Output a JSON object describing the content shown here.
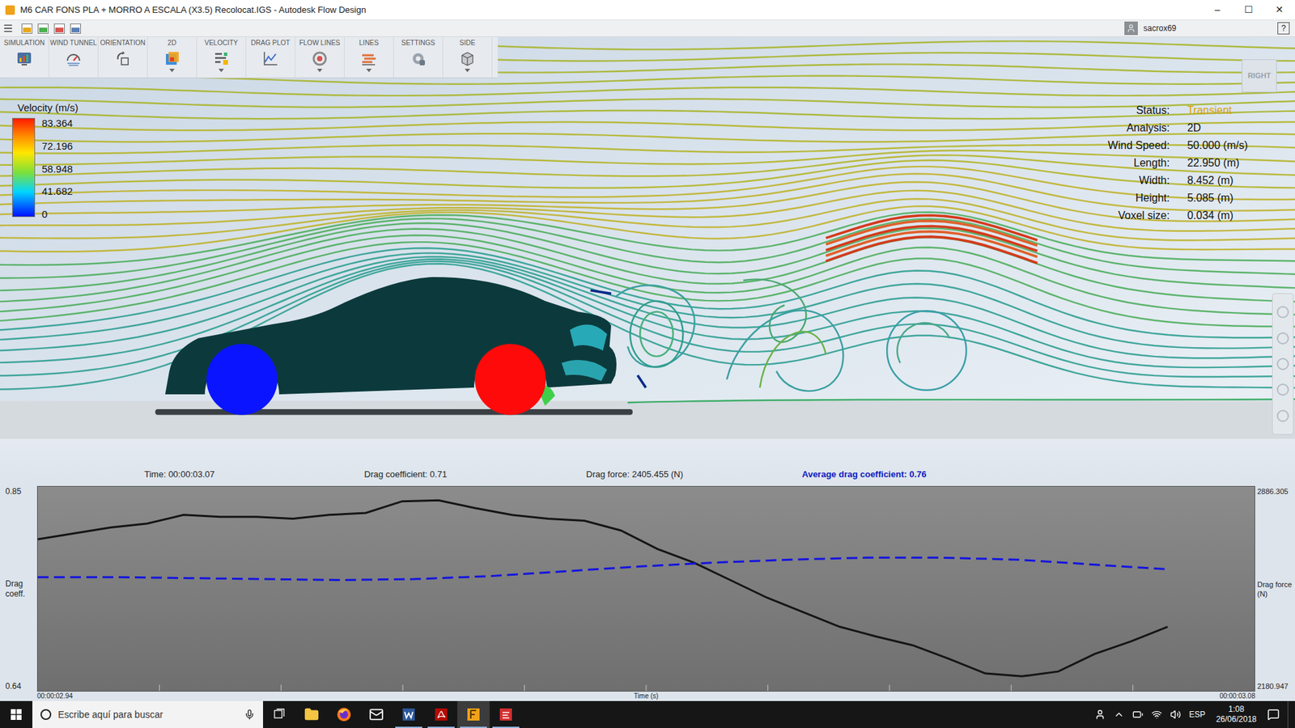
{
  "window": {
    "title": "M6 CAR FONS PLA + MORRO A ESCALA (X3.5) Recolocat.IGS - Autodesk Flow Design",
    "controls": [
      "–",
      "☐",
      "✕"
    ]
  },
  "quick_toolbar": {
    "user": "sacrox69",
    "help": "?"
  },
  "ribbon": [
    {
      "label": "SIMULATION",
      "has_dropdown": false
    },
    {
      "label": "WIND TUNNEL",
      "has_dropdown": false
    },
    {
      "label": "ORIENTATION",
      "has_dropdown": false
    },
    {
      "label": "2D",
      "has_dropdown": true
    },
    {
      "label": "VELOCITY",
      "has_dropdown": true
    },
    {
      "label": "DRAG PLOT",
      "has_dropdown": false
    },
    {
      "label": "FLOW LINES",
      "has_dropdown": true
    },
    {
      "label": "LINES",
      "has_dropdown": true
    },
    {
      "label": "SETTINGS",
      "has_dropdown": false
    },
    {
      "label": "SIDE",
      "has_dropdown": true
    }
  ],
  "legend": {
    "title": "Velocity (m/s)",
    "ticks": [
      "83.364",
      "72.196",
      "58.948",
      "41.682",
      "0"
    ]
  },
  "info": [
    {
      "label": "Status:",
      "value": "Transient",
      "highlight": true
    },
    {
      "label": "Analysis:",
      "value": "2D",
      "highlight": false
    },
    {
      "label": "Wind Speed:",
      "value": "50.000 (m/s)",
      "highlight": false
    },
    {
      "label": "Length:",
      "value": "22.950 (m)",
      "highlight": false
    },
    {
      "label": "Width:",
      "value": "8.452 (m)",
      "highlight": false
    },
    {
      "label": "Height:",
      "value": "5.085 (m)",
      "highlight": false
    },
    {
      "label": "Voxel size:",
      "value": "0.034 (m)",
      "highlight": false
    }
  ],
  "view_cube": {
    "label": "RIGHT"
  },
  "wheels": [
    {
      "color": "#0a14ff"
    },
    {
      "color": "#ff0a0a"
    }
  ],
  "readout": [
    {
      "kind": "time",
      "text": "Time: 00:00:03.07",
      "emphasis": false
    },
    {
      "kind": "coefficient",
      "text": "Drag coefficient: 0.71",
      "emphasis": false
    },
    {
      "kind": "force",
      "text": "Drag force: 2405.455 (N)",
      "emphasis": false
    },
    {
      "kind": "average",
      "text": "Average drag coefficient: 0.76",
      "emphasis": true
    }
  ],
  "chart": {
    "left_axis": {
      "label": "Drag coeff.",
      "max": "0.85",
      "min": "0.64"
    },
    "right_axis": {
      "label": "Drag force (N)",
      "max": "2886.305",
      "min": "2180.947"
    },
    "x_axis": {
      "label": "Time (s)",
      "start": "00:00:02.94",
      "end": "00:00:03.08"
    },
    "series": [
      {
        "name": "Drag coefficient",
        "color": "#151515",
        "style": "solid",
        "values": [
          0.796,
          0.802,
          0.808,
          0.812,
          0.821,
          0.819,
          0.819,
          0.817,
          0.821,
          0.823,
          0.835,
          0.836,
          0.828,
          0.821,
          0.817,
          0.815,
          0.805,
          0.786,
          0.772,
          0.754,
          0.736,
          0.721,
          0.706,
          0.696,
          0.687,
          0.673,
          0.658,
          0.655,
          0.66,
          0.678,
          0.691,
          0.706
        ]
      },
      {
        "name": "Average drag coefficient",
        "color": "#1414e0",
        "style": "dashed",
        "values": [
          0.757,
          0.757,
          0.756,
          0.755,
          0.754,
          0.755,
          0.758,
          0.763,
          0.768,
          0.772,
          0.775,
          0.777,
          0.777,
          0.775,
          0.77,
          0.765
        ]
      }
    ]
  },
  "taskbar": {
    "search_placeholder": "Escribe aquí para buscar",
    "apps": [
      {
        "kind": "task-view",
        "running": false,
        "active": false
      },
      {
        "kind": "explorer",
        "running": false,
        "active": false
      },
      {
        "kind": "firefox",
        "running": false,
        "active": false
      },
      {
        "kind": "mail",
        "running": false,
        "active": false
      },
      {
        "kind": "word",
        "running": true,
        "active": false
      },
      {
        "kind": "acrobat",
        "running": true,
        "active": false
      },
      {
        "kind": "flow-design",
        "running": true,
        "active": true
      },
      {
        "kind": "solidworks",
        "running": true,
        "active": false
      }
    ],
    "language": "ESP",
    "time": "1:08",
    "date": "26/06/2018"
  }
}
